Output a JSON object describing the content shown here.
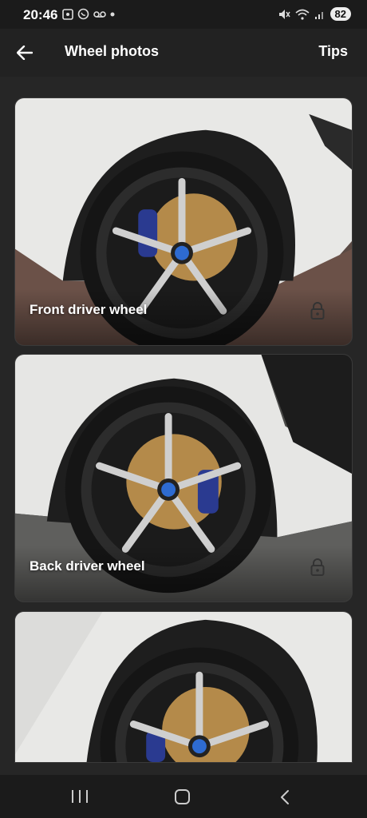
{
  "status_bar": {
    "time": "20:46",
    "left_icons": [
      "screenshot-icon",
      "whatsapp-icon",
      "voicemail-icon",
      "dot-icon"
    ],
    "right_icons": [
      "mute-icon",
      "wifi-icon",
      "signal-icon"
    ],
    "battery": "82"
  },
  "app_bar": {
    "title": "Wheel photos",
    "tips_label": "Tips"
  },
  "cards": [
    {
      "label": "Front driver wheel",
      "locked": true
    },
    {
      "label": "Back driver wheel",
      "locked": true
    },
    {
      "label": "",
      "locked": false
    }
  ],
  "colors": {
    "background": "#262626",
    "app_bar": "#222222",
    "text": "#ffffff"
  }
}
